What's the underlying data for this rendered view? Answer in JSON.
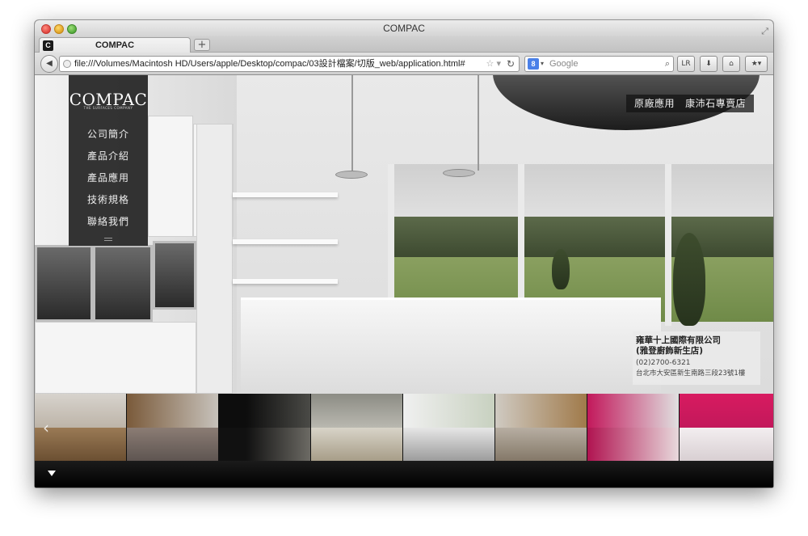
{
  "browser": {
    "window_title": "COMPAC",
    "tab_title": "COMPAC",
    "favicon_letter": "C",
    "new_tab_label": "+",
    "url": "file:///Volumes/Macintosh HD/Users/apple/Desktop/compac/03設計檔案/切版_web/application.html#",
    "search_placeholder": "Google",
    "search_engine_letter": "8",
    "reader_label": "LR",
    "icons": [
      "back-icon",
      "globe-icon",
      "star-icon",
      "reload-icon",
      "search-icon",
      "download-icon",
      "home-icon",
      "bookmarks-icon",
      "fullscreen-icon"
    ]
  },
  "site": {
    "logo": "COMPAC",
    "tagline": "THE SURFACES COMPANY",
    "nav": [
      "公司簡介",
      "產品介紹",
      "產品應用",
      "技術規格",
      "聯絡我們"
    ],
    "top_links": [
      "原廠應用",
      "康沛石專賣店"
    ],
    "contact": {
      "company": "雍華十上國際有限公司",
      "branch": "(雅登廚飾新生店)",
      "phone": "(02)2700-6321",
      "address": "台北市大安區新生南路三段23號1樓"
    },
    "thumbnails": [
      {
        "name": "open-kitchen-wood"
      },
      {
        "name": "kitchen-dark-counter"
      },
      {
        "name": "kitchen-black-interior"
      },
      {
        "name": "kitchen-window-shelving"
      },
      {
        "name": "kitchen-white-island"
      },
      {
        "name": "kitchen-wood-cabinets"
      },
      {
        "name": "pink-table-dishes"
      },
      {
        "name": "pink-living-room"
      }
    ],
    "colors": {
      "panel": "#232323",
      "accent_pink": "#c2185b",
      "footer": "#0d0d0d"
    }
  }
}
